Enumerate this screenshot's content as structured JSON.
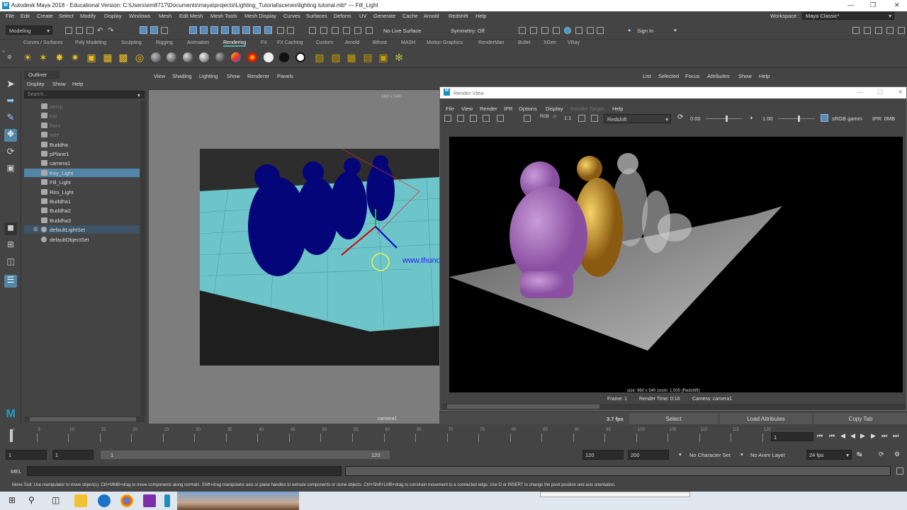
{
  "window": {
    "title": "Autodesk Maya 2018 - Educational Version: C:\\Users\\em8717\\Documents\\maya\\projects\\Lighting_Tutorial\\scenes\\lighting tutorial.mb*  ---  Fill_Light",
    "logo": "M"
  },
  "menubar": [
    "File",
    "Edit",
    "Create",
    "Select",
    "Modify",
    "Display",
    "Windows",
    "Mesh",
    "Edit Mesh",
    "Mesh Tools",
    "Mesh Display",
    "Curves",
    "Surfaces",
    "Deform",
    "UV",
    "Generate",
    "Cache",
    "Arnold",
    "Redshift",
    "Help"
  ],
  "workspace": {
    "label": "Workspace :",
    "value": "Maya Classic*"
  },
  "statusline": {
    "mode": "Modeling",
    "live_surface": "No Live Surface",
    "symmetry": "Symmetry: Off",
    "sign_in": "Sign In"
  },
  "shelf_tabs": [
    "Curves / Surfaces",
    "Poly Modeling",
    "Sculpting",
    "Rigging",
    "Animation",
    "Rendering",
    "FX",
    "FX Caching",
    "Custom",
    "Arnold",
    "Bifrost",
    "MASH",
    "Motion Graphics",
    "RenderMan",
    "Bullet",
    "XGen",
    "VRay"
  ],
  "shelf_active": "Rendering",
  "outliner": {
    "title": "Outliner",
    "menu": [
      "Display",
      "Show",
      "Help"
    ],
    "search_placeholder": "Search...",
    "items": [
      {
        "label": "persp",
        "state": "dim"
      },
      {
        "label": "top",
        "state": "dim"
      },
      {
        "label": "front",
        "state": "dim"
      },
      {
        "label": "side",
        "state": "dim"
      },
      {
        "label": "Buddha",
        "state": "normal"
      },
      {
        "label": "pPlane1",
        "state": "normal"
      },
      {
        "label": "camera1",
        "state": "normal"
      },
      {
        "label": "Key_Light",
        "state": "selected"
      },
      {
        "label": "Fill_Light",
        "state": "normal"
      },
      {
        "label": "Rim_Light",
        "state": "normal"
      },
      {
        "label": "Buddha1",
        "state": "normal"
      },
      {
        "label": "Buddha2",
        "state": "normal"
      },
      {
        "label": "Buddha3",
        "state": "normal"
      },
      {
        "label": "defaultLightSet",
        "state": "highlight"
      },
      {
        "label": "defaultObjectSet",
        "state": "normal"
      }
    ]
  },
  "viewport": {
    "menu": [
      "View",
      "Shading",
      "Lighting",
      "Show",
      "Renderer",
      "Panels"
    ],
    "resolution": "960 x 540",
    "camera": "camera1",
    "watermark": "www.thundershare.net"
  },
  "right_panel_menu": [
    "List",
    "Selected",
    "Focus",
    "Attributes",
    "Show",
    "Help"
  ],
  "render_view": {
    "title": "Render View",
    "menu": [
      "File",
      "View",
      "Render",
      "IPR",
      "Options",
      "Display",
      "Render Target",
      "Help"
    ],
    "zoom_label": "1:1",
    "renderer": "Redshift",
    "exposure": "0.00",
    "gamma": "1.00",
    "colorspace": "sRGB gamm",
    "ipr": "IPR: 0MB",
    "info": "size: 960 x 540  zoom: 1.000      (Redshift)",
    "frame": "Frame: 1",
    "render_time": "Render Time: 0:16",
    "camera": "Camera: camera1"
  },
  "bottom_bar": {
    "fps": "3.7 fps",
    "select": "Select",
    "load_attributes": "Load Attributes",
    "copy_tab": "Copy Tab"
  },
  "timeline": {
    "ticks": [
      "1",
      "5",
      "10",
      "15",
      "20",
      "25",
      "30",
      "35",
      "40",
      "45",
      "50",
      "55",
      "60",
      "65",
      "70",
      "75",
      "80",
      "85",
      "90",
      "95",
      "100",
      "105",
      "110",
      "115",
      "120"
    ],
    "current_frame": "1"
  },
  "range": {
    "start": "1",
    "start2": "1",
    "slider_start": "1",
    "slider_end": "120",
    "end": "120",
    "end2": "200",
    "character_set": "No Character Set",
    "anim_layer": "No Anim Layer",
    "fps": "24 fps"
  },
  "mel": {
    "label": "MEL"
  },
  "help_line": "Move Tool: Use manipulator to move object(s). Ctrl+MMB+drag to move components along normals. Shift+drag manipulator axis or plane handles to extrude components or clone objects. Ctrl+Shift+LMB+drag to constrain movement to a connected edge. Use D or INSERT to change the pivot position and axis orientation."
}
